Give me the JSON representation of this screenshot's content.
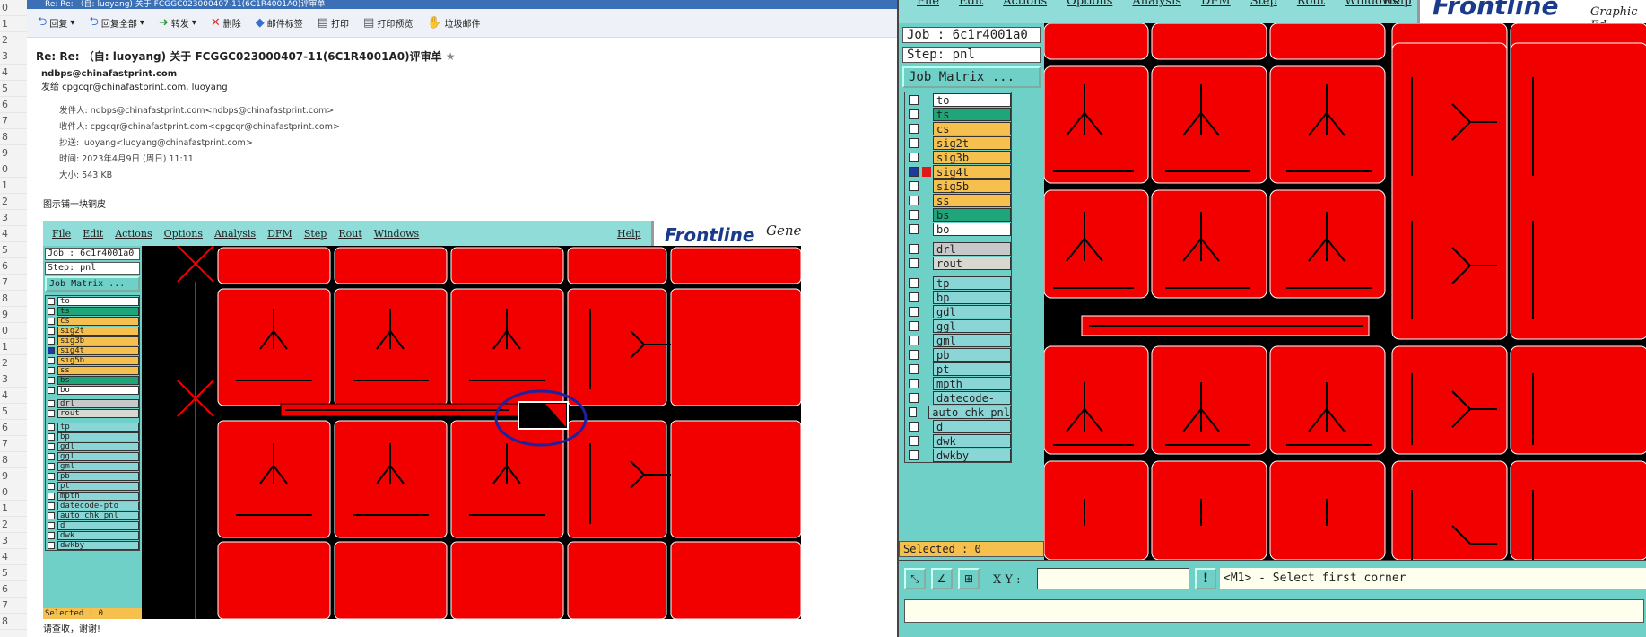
{
  "gutter": {
    "rows": [
      "0",
      "1",
      "2",
      "3",
      "4",
      "5",
      "6",
      "7",
      "8",
      "9",
      "0",
      "1",
      "2",
      "3",
      "4",
      "5",
      "6",
      "7",
      "8",
      "9",
      "0",
      "1",
      "2",
      "3",
      "4",
      "5",
      "6",
      "7",
      "8",
      "9",
      "0",
      "1",
      "2",
      "3",
      "4",
      "5",
      "6",
      "7",
      "8"
    ]
  },
  "mail": {
    "title": "Re: Re: （自: luoyang) 关于 FCGGC023000407-11(6C1R4001A0)评审单",
    "toolbar": [
      "回复",
      "回复全部",
      "转发",
      "删除",
      "邮件标签",
      "打印",
      "打印预览",
      "垃圾邮件"
    ],
    "subject": "Re: Re: （自: luoyang) 关于 FCGGC023000407-11(6C1R4001A0)评审单",
    "from_name": "ndbps@chinafastprint.com",
    "send_to": "发给 cpgcqr@chinafastprint.com, luoyang",
    "details": {
      "sender": "发件人: ndbps@chinafastprint.com<ndbps@chinafastprint.com>",
      "recipient": "收件人: cpgcqr@chinafastprint.com<cpgcqr@chinafastprint.com>",
      "cc": "抄送: luoyang<luoyang@chinafastprint.com>",
      "time": "时间: 2023年4月9日 (周日) 11:11",
      "size": "大小: 543 KB"
    },
    "body": "图示铺一块铜皮",
    "closing": "请查收，谢谢!"
  },
  "shot": {
    "menu": [
      "File",
      "Edit",
      "Actions",
      "Options",
      "Analysis",
      "DFM",
      "Step",
      "Rout",
      "Windows"
    ],
    "help": "Help",
    "logo": "Frontline",
    "logo2": "Genes",
    "job": "Job : 6c1r4001a0",
    "step": "Step: pnl",
    "job_matrix": "Job Matrix ...",
    "selected": "Selected : 0"
  },
  "gen": {
    "menu": [
      "File",
      "Edit",
      "Actions",
      "Options",
      "Analysis",
      "DFM",
      "Step",
      "Rout",
      "Windows"
    ],
    "help": "Help",
    "logo": "Frontline",
    "logo_sub": "Graphic Ed",
    "job": "Job : 6c1r4001a0",
    "step": "Step: pnl",
    "job_matrix": "Job Matrix ...",
    "selected": "Selected : 0",
    "xy_label": "X Y :",
    "message": "<M1> - Select first corner"
  },
  "layers": [
    {
      "name": "to",
      "color": "#ffffff"
    },
    {
      "name": "ts",
      "color": "#1fa57a"
    },
    {
      "name": "cs",
      "color": "#f6c04e"
    },
    {
      "name": "sig2t",
      "color": "#f6c04e"
    },
    {
      "name": "sig3b",
      "color": "#f6c04e"
    },
    {
      "name": "sig4t",
      "color": "#f6c04e"
    },
    {
      "name": "sig5b",
      "color": "#f6c04e"
    },
    {
      "name": "ss",
      "color": "#f6c04e"
    },
    {
      "name": "bs",
      "color": "#1fa57a"
    },
    {
      "name": "bo",
      "color": "#ffffff"
    },
    {
      "name": "drl",
      "color": "#c8c8c8"
    },
    {
      "name": "rout",
      "color": "#d8d8d0"
    },
    {
      "name": "tp",
      "color": "#8ad6d6"
    },
    {
      "name": "bp",
      "color": "#8ad6d6"
    },
    {
      "name": "gdl",
      "color": "#8ad6d6"
    },
    {
      "name": "ggl",
      "color": "#8ad6d6"
    },
    {
      "name": "gml",
      "color": "#8ad6d6"
    },
    {
      "name": "pb",
      "color": "#8ad6d6"
    },
    {
      "name": "pt",
      "color": "#8ad6d6"
    },
    {
      "name": "mpth",
      "color": "#8ad6d6"
    },
    {
      "name": "datecode-pto",
      "color": "#8ad6d6"
    },
    {
      "name": "auto_chk_pnl",
      "color": "#8ad6d6"
    },
    {
      "name": "d",
      "color": "#8ad6d6"
    },
    {
      "name": "dwk",
      "color": "#8ad6d6"
    },
    {
      "name": "dwkby",
      "color": "#8ad6d6"
    }
  ]
}
